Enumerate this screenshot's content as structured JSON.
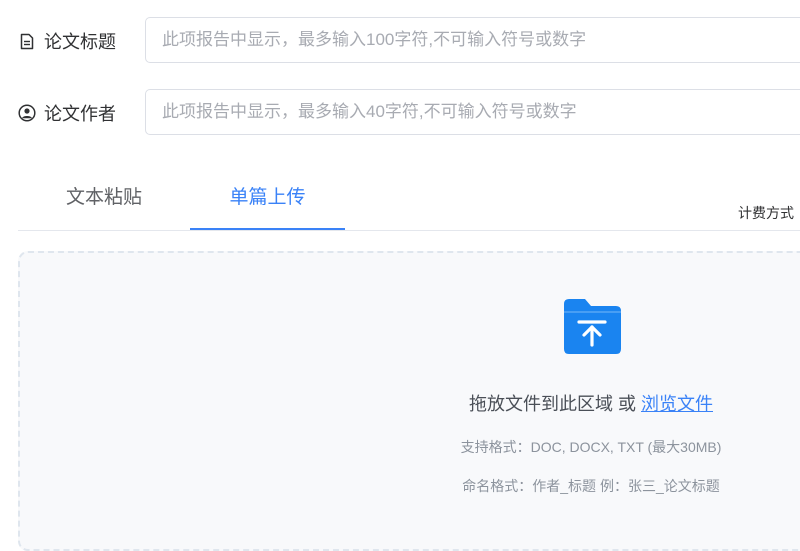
{
  "form": {
    "title": {
      "label": "论文标题",
      "icon": "document-icon",
      "placeholder": "此项报告中显示，最多输入100字符,不可输入符号或数字"
    },
    "author": {
      "label": "论文作者",
      "icon": "user-circle-icon",
      "placeholder": "此项报告中显示，最多输入40字符,不可输入符号或数字"
    }
  },
  "tabs": [
    {
      "label": "文本粘贴",
      "active": false
    },
    {
      "label": "单篇上传",
      "active": true
    }
  ],
  "billing_label": "计费方式",
  "upload": {
    "icon": "folder-upload-icon",
    "drop_text": "拖放文件到此区域 或 ",
    "browse_link": "浏览文件",
    "formats_hint": "支持格式：DOC, DOCX, TXT (最大30MB)",
    "naming_hint": "命名格式：作者_标题 例：张三_论文标题"
  },
  "colors": {
    "accent": "#3a82f7",
    "folder": "#1a84f0"
  }
}
